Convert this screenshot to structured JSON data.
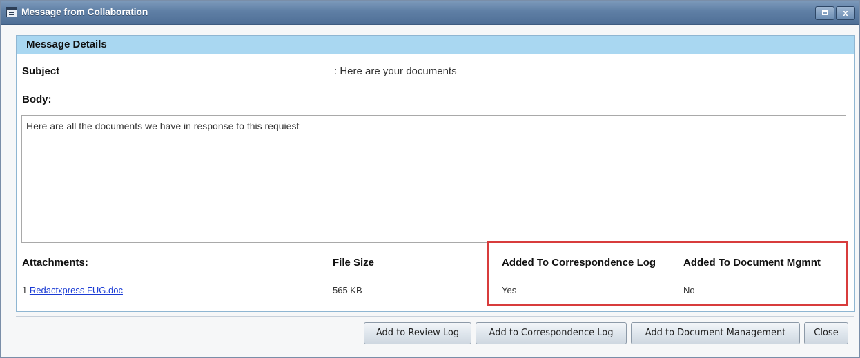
{
  "window": {
    "title": "Message from Collaboration",
    "close_glyph": "x"
  },
  "details": {
    "header": "Message Details",
    "subject_label": "Subject",
    "subject_value": ":  Here are your documents",
    "body_label": "Body:",
    "body_text": "Here are all the documents we have in response to this requiest",
    "columns": {
      "attachments": "Attachments:",
      "file_size": "File Size",
      "correspondence": "Added To Correspondence Log",
      "document_mgmt": "Added To Document Mgmnt"
    },
    "attachments": [
      {
        "index": "1",
        "name": "Redactxpress FUG.doc",
        "size": "565 KB",
        "in_correspondence": "Yes",
        "in_document_mgmt": "No"
      }
    ]
  },
  "buttons": {
    "review": "Add to Review Log",
    "correspondence": "Add to Correspondence Log",
    "document": "Add to Document Management",
    "close": "Close"
  },
  "colors": {
    "titlebar": "#5f7fa5",
    "section_header": "#a9d7f1",
    "highlight": "#d83c3c",
    "link": "#1a3bd4"
  },
  "icons": {
    "window": "document-list-icon",
    "maximize": "maximize-icon",
    "close": "close-icon"
  }
}
